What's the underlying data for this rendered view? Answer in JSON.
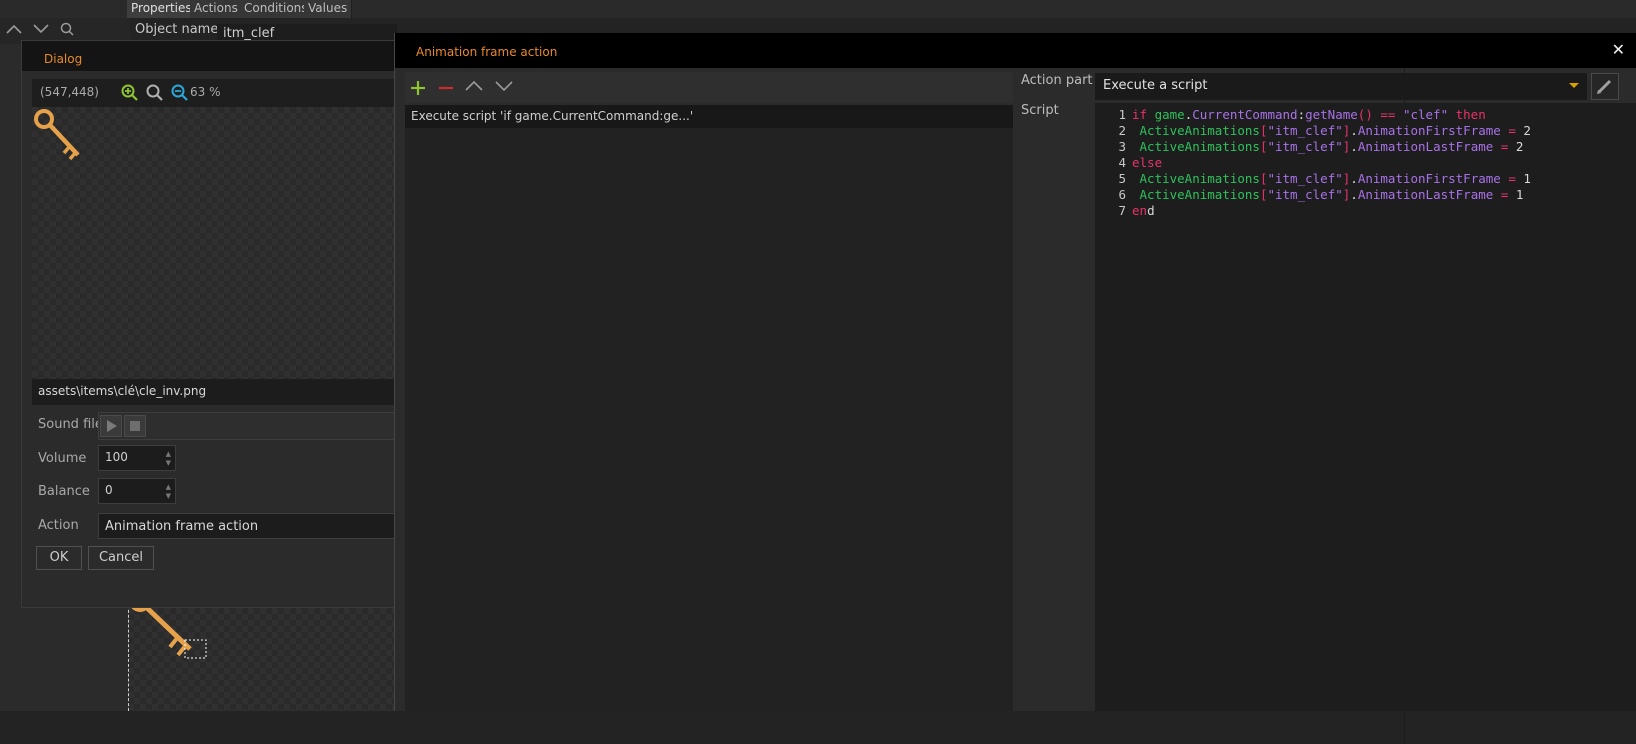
{
  "background_editor": {
    "tabs": [
      "Properties",
      "Actions",
      "Conditions",
      "Values"
    ],
    "object_name_label": "Object name",
    "object_name_value": "itm_clef"
  },
  "dialog": {
    "title": "Dialog",
    "coords": "(547,448)",
    "zoom": "63 %",
    "image_path": "assets\\items\\clé\\cle_inv.png",
    "sound_file_label": "Sound file",
    "volume_label": "Volume",
    "volume_value": "100",
    "balance_label": "Balance",
    "balance_value": "0",
    "action_label": "Action",
    "action_value": "Animation frame action",
    "ok_label": "OK",
    "cancel_label": "Cancel"
  },
  "main_window": {
    "title": "Animation frame action",
    "close_glyph": "✕",
    "list_items": [
      "Execute script 'if game.CurrentCommand:ge...'"
    ],
    "action_part_label": "Action part",
    "action_part_value": "Execute a script",
    "script_label": "Script"
  },
  "script_lines": [
    "if game.CurrentCommand:getName() == \"clef\" then",
    " ActiveAnimations[\"itm_clef\"].AnimationFirstFrame = 2",
    " ActiveAnimations[\"itm_clef\"].AnimationLastFrame = 2",
    "else",
    " ActiveAnimations[\"itm_clef\"].AnimationFirstFrame = 1",
    " ActiveAnimations[\"itm_clef\"].AnimationLastFrame = 1",
    "end"
  ],
  "colors": {
    "title_accent": "#e8892a",
    "keyword": "#e8336a",
    "identifier": "#a872e8",
    "class_name": "#2ec15c",
    "add_icon": "#8fc531",
    "remove_icon": "#d22a2a"
  }
}
